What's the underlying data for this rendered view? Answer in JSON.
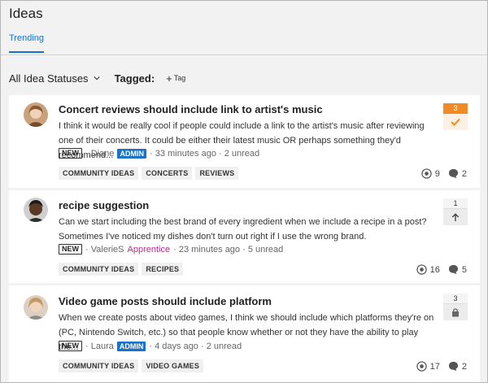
{
  "page": {
    "title": "Ideas"
  },
  "tabs": [
    {
      "label": "Trending"
    }
  ],
  "filters": {
    "status_label": "All Idea Statuses",
    "tagged_label": "Tagged:",
    "add_tag_label": "Tag"
  },
  "ideas": [
    {
      "title": "Concert reviews should include link to artist's music",
      "excerpt": "I think it would be really cool if people could include a link to the artist's music after reviewing one of their concerts. It could be either their latest music OR perhaps something they'd recommend...",
      "new_badge": "NEW",
      "author": "Diane",
      "role": "ADMIN",
      "time": "33 minutes ago",
      "unread": "2 unread",
      "tags": [
        "COMMUNITY IDEAS",
        "CONCERTS",
        "REVIEWS"
      ],
      "views": "9",
      "comments": "2",
      "votes": "3",
      "vote_state": "voted",
      "vote_color": "#f08a24"
    },
    {
      "title": "recipe suggestion",
      "excerpt": "Can we start including the best brand of every ingredient when we include a recipe in a post? Sometimes I've noticed my dishes don't turn out right if I use the wrong brand.",
      "new_badge": "NEW",
      "author": "ValerieS",
      "role": "Apprentice",
      "time": "23 minutes ago",
      "unread": "5 unread",
      "tags": [
        "COMMUNITY IDEAS",
        "RECIPES"
      ],
      "views": "16",
      "comments": "5",
      "votes": "1",
      "vote_state": "upvote"
    },
    {
      "title": "Video game posts should include platform",
      "excerpt": "When we create posts about video games, I think we should include which platforms they're on (PC, Nintendo Switch, etc.) so that people know whether or not they have the ability to play the...",
      "new_badge": "NEW",
      "author": "Laura",
      "role": "ADMIN",
      "time": "4 days ago",
      "unread": "2 unread",
      "tags": [
        "COMMUNITY IDEAS",
        "VIDEO GAMES"
      ],
      "views": "17",
      "comments": "2",
      "votes": "3",
      "vote_state": "locked"
    }
  ],
  "colors": {
    "accent": "#1a73c8",
    "vote_orange": "#f08a24",
    "apprentice": "#c0288f"
  }
}
